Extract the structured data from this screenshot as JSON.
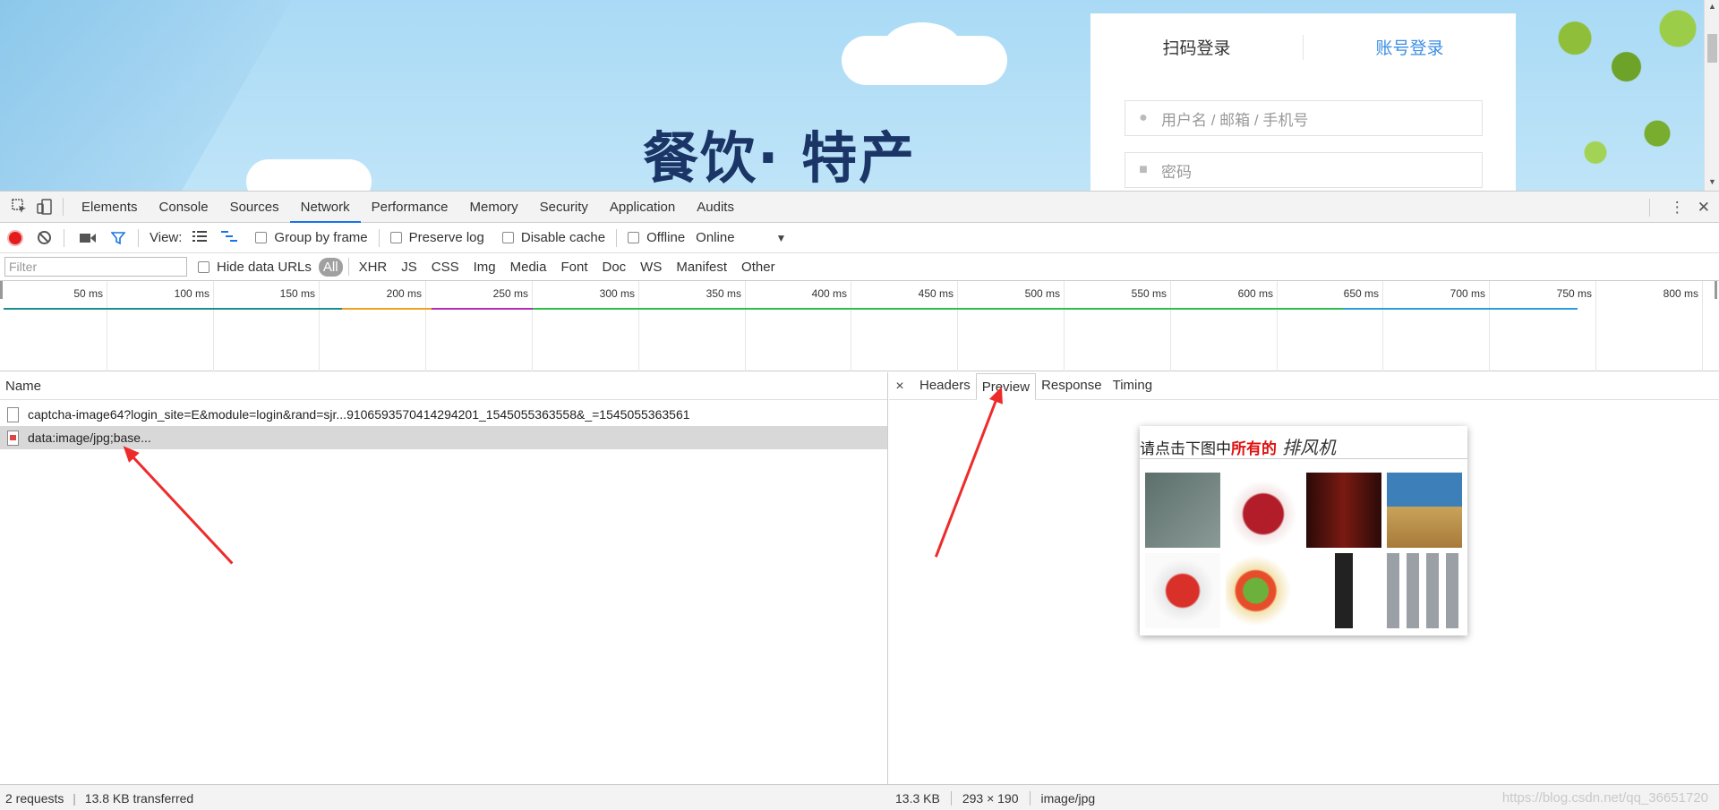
{
  "page": {
    "banner_title": "餐饮· 特产",
    "login": {
      "tabs": [
        {
          "label": "扫码登录"
        },
        {
          "label": "账号登录"
        }
      ],
      "username_placeholder": "用户名 / 邮箱 / 手机号",
      "password_placeholder": "密码"
    }
  },
  "devtools": {
    "panel_tabs": [
      "Elements",
      "Console",
      "Sources",
      "Network",
      "Performance",
      "Memory",
      "Security",
      "Application",
      "Audits"
    ],
    "active_panel": "Network",
    "toolbar": {
      "view_label": "View:",
      "group_by_frame": "Group by frame",
      "preserve_log": "Preserve log",
      "disable_cache": "Disable cache",
      "offline": "Offline",
      "throttle": "Online"
    },
    "filter": {
      "placeholder": "Filter",
      "hide_data_urls": "Hide data URLs",
      "types": [
        "All",
        "XHR",
        "JS",
        "CSS",
        "Img",
        "Media",
        "Font",
        "Doc",
        "WS",
        "Manifest",
        "Other"
      ],
      "active_type": "All"
    },
    "overview_ticks": [
      "50 ms",
      "100 ms",
      "150 ms",
      "200 ms",
      "250 ms",
      "300 ms",
      "350 ms",
      "400 ms",
      "450 ms",
      "500 ms",
      "550 ms",
      "600 ms",
      "650 ms",
      "700 ms",
      "750 ms",
      "800 ms"
    ],
    "list_header": "Name",
    "requests": [
      {
        "name": "captcha-image64?login_site=E&module=login&rand=sjr...9106593570414294201_1545055363558&_=1545055363561",
        "selected": false
      },
      {
        "name": "data:image/jpg;base...",
        "selected": true
      }
    ],
    "detail_tabs": [
      "Headers",
      "Preview",
      "Response",
      "Timing"
    ],
    "active_detail_tab": "Preview",
    "captcha": {
      "prompt": "请点击下图中",
      "highlight": "所有的",
      "target": "排风机"
    },
    "status": {
      "requests": "2 requests",
      "transferred": "13.8 KB transferred",
      "size": "13.3 KB",
      "dimensions": "293 × 190",
      "mime": "image/jpg",
      "watermark": "https://blog.csdn.net/qq_36651720"
    }
  }
}
